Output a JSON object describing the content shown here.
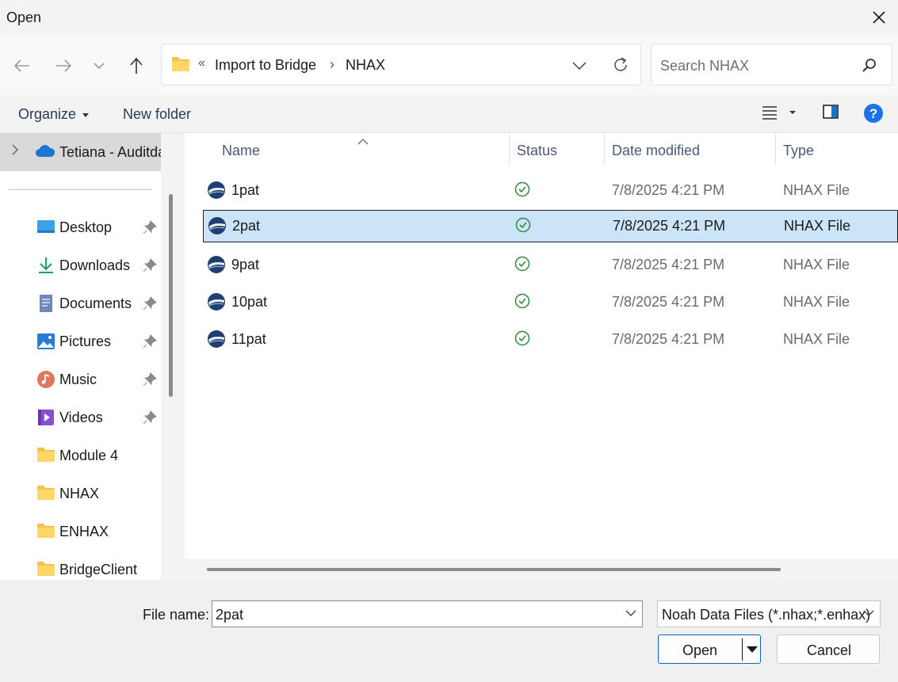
{
  "window": {
    "title": "Open"
  },
  "nav": {
    "breadcrumb_overflow": "«",
    "crumbs": [
      "Import to Bridge",
      "NHAX"
    ],
    "separator": "›",
    "search_placeholder": "Search NHAX"
  },
  "toolbar": {
    "organize_label": "Organize",
    "new_folder_label": "New folder"
  },
  "sidebar": {
    "onedrive_label": "Tetiana - Auditda",
    "items": [
      {
        "label": "Desktop",
        "icon": "desktop-icon",
        "pinned": true
      },
      {
        "label": "Downloads",
        "icon": "downloads-icon",
        "pinned": true
      },
      {
        "label": "Documents",
        "icon": "documents-icon",
        "pinned": true
      },
      {
        "label": "Pictures",
        "icon": "pictures-icon",
        "pinned": true
      },
      {
        "label": "Music",
        "icon": "music-icon",
        "pinned": true
      },
      {
        "label": "Videos",
        "icon": "videos-icon",
        "pinned": true
      },
      {
        "label": "Module 4",
        "icon": "folder-icon",
        "pinned": false
      },
      {
        "label": "NHAX",
        "icon": "folder-icon",
        "pinned": false
      },
      {
        "label": "ENHAX",
        "icon": "folder-icon",
        "pinned": false
      },
      {
        "label": "BridgeClient",
        "icon": "folder-icon",
        "pinned": false
      }
    ]
  },
  "columns": {
    "name": "Name",
    "status": "Status",
    "date": "Date modified",
    "type": "Type"
  },
  "files": [
    {
      "name": "1pat",
      "date": "7/8/2025 4:21 PM",
      "type": "NHAX File",
      "selected": false
    },
    {
      "name": "2pat",
      "date": "7/8/2025 4:21 PM",
      "type": "NHAX File",
      "selected": true
    },
    {
      "name": "9pat",
      "date": "7/8/2025 4:21 PM",
      "type": "NHAX File",
      "selected": false
    },
    {
      "name": "10pat",
      "date": "7/8/2025 4:21 PM",
      "type": "NHAX File",
      "selected": false
    },
    {
      "name": "11pat",
      "date": "7/8/2025 4:21 PM",
      "type": "NHAX File",
      "selected": false
    }
  ],
  "footer": {
    "file_name_label": "File name:",
    "file_name_value": "2pat",
    "file_type_value": "Noah Data Files (*.nhax;*.enhax)",
    "open_label": "Open",
    "cancel_label": "Cancel"
  },
  "colors": {
    "accent": "#0067c0",
    "selection": "#cce4f7",
    "status_ok": "#2e8b3e",
    "folder": "#f6c14a"
  }
}
